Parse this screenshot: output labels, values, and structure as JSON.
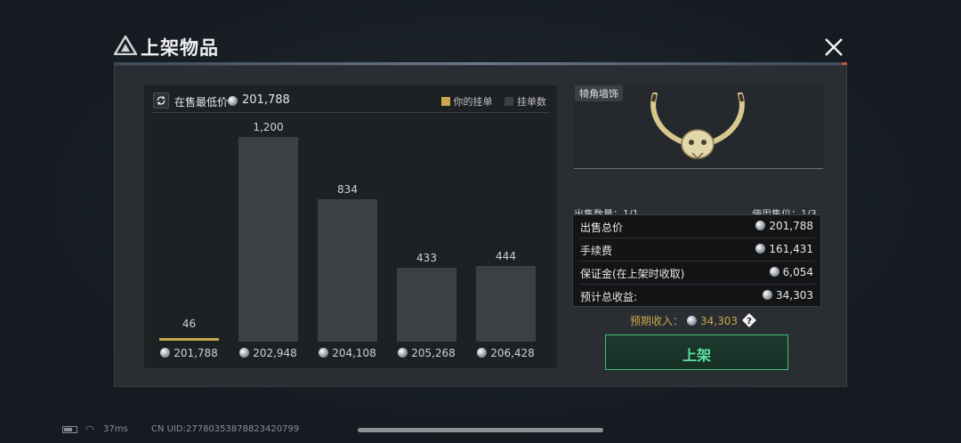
{
  "header": {
    "title": "上架物品",
    "close_icon": "close-icon"
  },
  "chart_panel": {
    "lowest_price_label": "在售最低价",
    "lowest_price_value": "201,788",
    "legend": [
      {
        "label": "你的挂单",
        "color": "#c9a84b"
      },
      {
        "label": "挂单数",
        "color": "#3c3f43"
      }
    ]
  },
  "chart_data": {
    "type": "bar",
    "categories": [
      "201,788",
      "202,948",
      "204,108",
      "205,268",
      "206,428"
    ],
    "series": [
      {
        "name": "挂单数",
        "values": [
          46,
          1200,
          834,
          433,
          444
        ]
      }
    ],
    "data_labels": [
      "46",
      "1,200",
      "834",
      "433",
      "444"
    ],
    "highlighted_category_index": 0,
    "ylim": [
      0,
      1200
    ]
  },
  "item": {
    "name": "犄角墙饰",
    "sale_quantity": "出售数量：1/1",
    "slots_used": "使用售位：1/3"
  },
  "summary": {
    "rows": [
      {
        "label": "出售总价",
        "value": "201,788"
      },
      {
        "label": "手续费",
        "value": "161,431"
      },
      {
        "label": "保证金(在上架时收取)",
        "value": "6,054"
      },
      {
        "label": "预计总收益:",
        "value": "34,303"
      }
    ]
  },
  "expected_income": {
    "label": "预期收入：",
    "value": "34,303"
  },
  "list_button": {
    "label": "上架"
  },
  "status_bar": {
    "ping": "37ms",
    "uid": "CN UID:2778035387882342079​9"
  }
}
